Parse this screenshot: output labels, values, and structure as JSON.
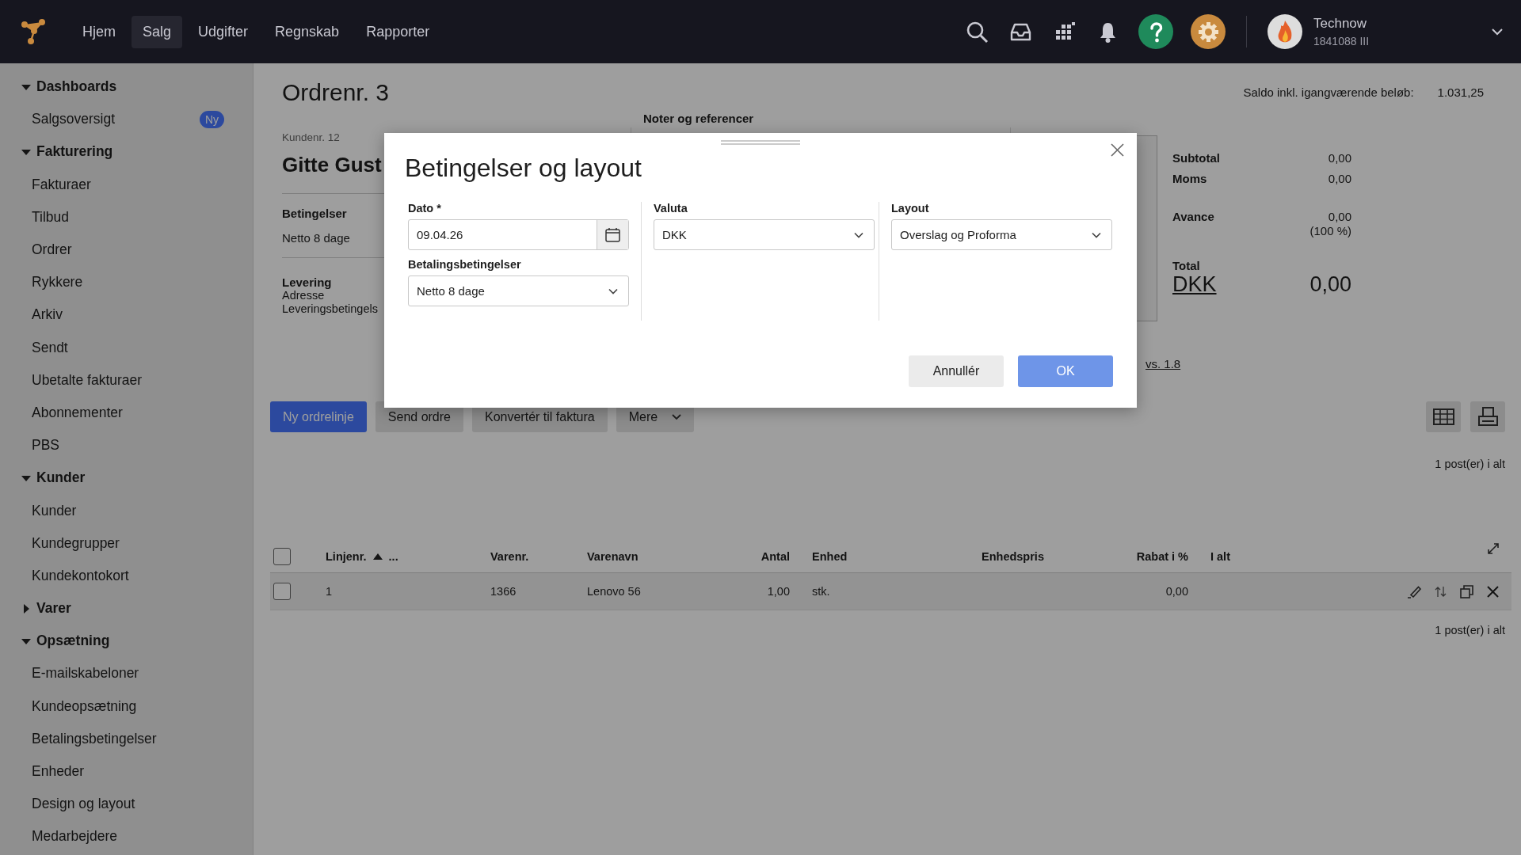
{
  "topbar": {
    "nav": [
      {
        "label": "Hjem",
        "selected": false
      },
      {
        "label": "Salg",
        "selected": true
      },
      {
        "label": "Udgifter",
        "selected": false
      },
      {
        "label": "Regnskab",
        "selected": false
      },
      {
        "label": "Rapporter",
        "selected": false
      }
    ],
    "user": {
      "name": "Technow",
      "account": "1841088 III"
    }
  },
  "sidebar": {
    "sections": [
      {
        "label": "Dashboards",
        "expanded": true,
        "children": [
          {
            "label": "Salgsoversigt",
            "badge": "Ny"
          }
        ]
      },
      {
        "label": "Fakturering",
        "expanded": true,
        "children": [
          {
            "label": "Fakturaer"
          },
          {
            "label": "Tilbud"
          },
          {
            "label": "Ordrer"
          },
          {
            "label": "Rykkere"
          },
          {
            "label": "Arkiv"
          },
          {
            "label": "Sendt"
          },
          {
            "label": "Ubetalte fakturaer"
          },
          {
            "label": "Abonnementer"
          },
          {
            "label": "PBS"
          }
        ]
      },
      {
        "label": "Kunder",
        "expanded": true,
        "children": [
          {
            "label": "Kunder"
          },
          {
            "label": "Kundegrupper"
          },
          {
            "label": "Kundekontokort"
          }
        ]
      },
      {
        "label": "Varer",
        "expanded": false
      },
      {
        "label": "Opsætning",
        "expanded": true,
        "children": [
          {
            "label": "E-mailskabeloner"
          },
          {
            "label": "Kundeopsætning"
          },
          {
            "label": "Betalingsbetingelser"
          },
          {
            "label": "Enheder"
          },
          {
            "label": "Design og layout"
          },
          {
            "label": "Medarbejdere"
          }
        ]
      }
    ]
  },
  "page": {
    "title": "Ordrenr. 3",
    "balance_label": "Saldo inkl. igangværende beløb:",
    "balance": "1.031,25",
    "customer": {
      "number": "Kundenr. 12",
      "name": "Gitte Gust",
      "terms_label": "Betingelser",
      "terms": "Netto 8 dage",
      "delivery_label": "Levering",
      "delivery_lines": [
        "Adresse",
        "Leveringsbetingels"
      ]
    },
    "notes_label": "Noter og referencer",
    "summary": {
      "rows": [
        {
          "label": "Subtotal",
          "value": "0,00"
        },
        {
          "label": "Moms",
          "value": "0,00"
        },
        {
          "label": "Avance",
          "value": "0,00",
          "sub": "(100 %)"
        }
      ],
      "total_label": "Total",
      "currency": "DKK",
      "total": "0,00"
    },
    "version_link": "vs. 1.8",
    "actions": [
      {
        "label": "Ny ordrelinje",
        "kind": "primary"
      },
      {
        "label": "Send ordre",
        "kind": "secondary"
      },
      {
        "label": "Konvertér til faktura",
        "kind": "secondary"
      },
      {
        "label": "Mere",
        "kind": "menu"
      }
    ],
    "count_top": "1 post(er) i alt",
    "table": {
      "all_checked": false,
      "columns": [
        {
          "kind": "text",
          "label": "Linjenr.",
          "sorted_ascending": true,
          "extra": "..."
        },
        {
          "kind": "text",
          "label": "Varenr."
        },
        {
          "kind": "text",
          "label": "Varenavn"
        },
        {
          "kind": "number",
          "label": "Antal"
        },
        {
          "kind": "text",
          "label": "Enhed"
        },
        {
          "kind": "text",
          "label": "Enhedspris"
        },
        {
          "kind": "number",
          "label": "Rabat i %"
        },
        {
          "kind": "text",
          "label": "I alt"
        }
      ],
      "rows": [
        {
          "checked": false,
          "cells": [
            "1",
            "1366",
            "Lenovo 56",
            "1,00",
            "stk.",
            null,
            "0,00",
            null
          ]
        }
      ]
    },
    "count_bottom": "1 post(er) i alt"
  },
  "dialog": {
    "title": "Betingelser og layout",
    "columns": [
      [
        {
          "label": "Dato *",
          "value": "09.04.26",
          "kind": "date"
        },
        {
          "label": "Betalingsbetingelser",
          "value": "Netto 8 dage",
          "kind": "select"
        }
      ],
      [
        {
          "label": "Valuta",
          "value": "DKK",
          "kind": "select"
        }
      ],
      [
        {
          "label": "Layout",
          "value": "Overslag og Proforma",
          "kind": "select"
        }
      ]
    ],
    "buttons": [
      {
        "label": "Annullér",
        "kind": "secondary"
      },
      {
        "label": "OK",
        "kind": "primary"
      }
    ]
  }
}
